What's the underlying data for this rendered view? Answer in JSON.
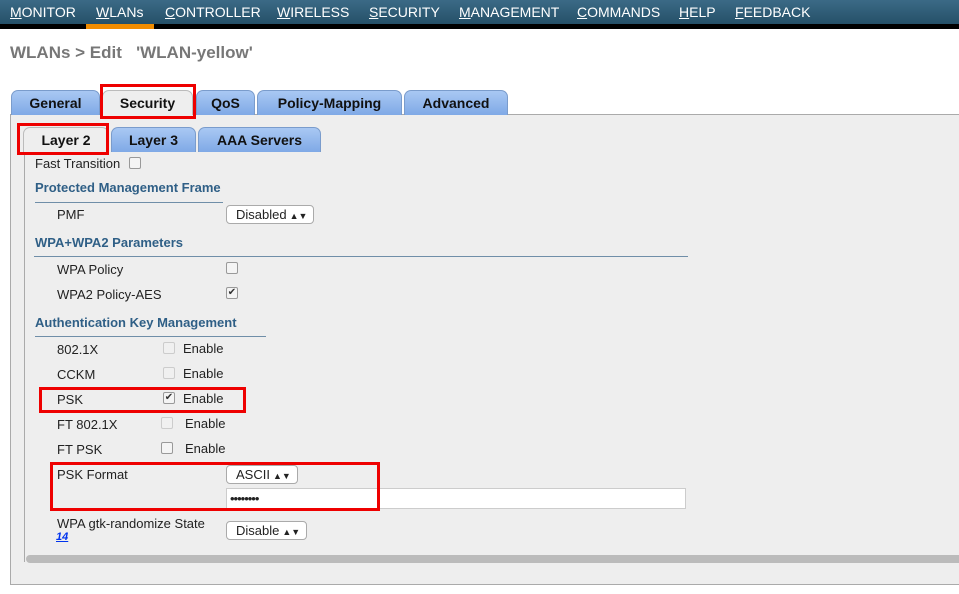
{
  "nav": {
    "items": [
      "MONITOR",
      "WLANs",
      "CONTROLLER",
      "WIRELESS",
      "SECURITY",
      "MANAGEMENT",
      "COMMANDS",
      "HELP",
      "FEEDBACK"
    ],
    "active": "WLANs",
    "active_color": "#f08c00"
  },
  "page": {
    "title": "WLANs > Edit   'WLAN-yellow'"
  },
  "tabs": [
    "General",
    "Security",
    "QoS",
    "Policy-Mapping",
    "Advanced"
  ],
  "active_tab": "Security",
  "subtabs": [
    "Layer 2",
    "Layer 3",
    "AAA Servers"
  ],
  "active_subtab": "Layer 2",
  "fast_transition": {
    "label": "Fast Transition",
    "checked": false
  },
  "pmf_section": {
    "title": "Protected Management Frame",
    "pmf_label": "PMF",
    "pmf_value": "Disabled"
  },
  "wpa_section": {
    "title": "WPA+WPA2 Parameters",
    "wpa_policy": {
      "label": "WPA Policy",
      "checked": false
    },
    "wpa2_policy": {
      "label": "WPA2 Policy-AES",
      "checked": true
    }
  },
  "akm_section": {
    "title": "Authentication Key Management",
    "enable_label": "Enable",
    "rows": [
      {
        "label": "802.1X",
        "checked": false,
        "disabled": true
      },
      {
        "label": "CCKM",
        "checked": false,
        "disabled": true
      },
      {
        "label": "PSK",
        "checked": true,
        "disabled": false
      },
      {
        "label": "FT 802.1X",
        "checked": false,
        "disabled": true
      },
      {
        "label": "FT PSK",
        "checked": false,
        "disabled": false
      }
    ]
  },
  "psk_format": {
    "label": "PSK Format",
    "value": "ASCII",
    "password": "••••••••"
  },
  "gtk": {
    "label": "WPA gtk-randomize State",
    "value": "Disable",
    "footnote": "14"
  },
  "highlight_color": "#e00000"
}
